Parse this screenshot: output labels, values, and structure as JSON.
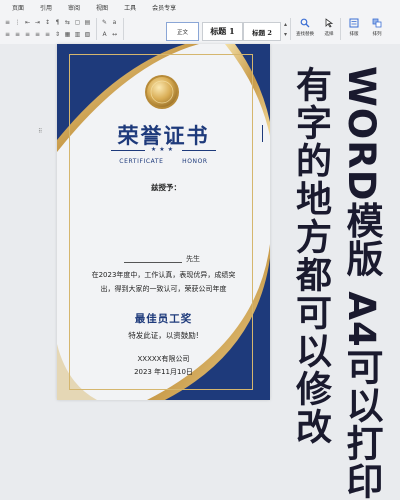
{
  "ribbon": {
    "menu": [
      "页面",
      "引用",
      "审阅",
      "视图",
      "工具",
      "会员专享"
    ],
    "styles": [
      "正文",
      "标题 1",
      "标题 2"
    ],
    "right_buttons": [
      {
        "label": "查找替换",
        "icon": "find-replace-icon"
      },
      {
        "label": "选择",
        "icon": "select-icon"
      },
      {
        "label": "排版",
        "icon": "layout-icon"
      },
      {
        "label": "排列",
        "icon": "arrange-icon"
      }
    ]
  },
  "certificate": {
    "title": "荣誉证书",
    "stars": "★★★",
    "subtitle_left": "CERTIFICATE",
    "subtitle_right": "HONOR",
    "award_to": "兹授予：",
    "honorific": "先生",
    "body_line1": "在2023年度中，工作认真，表现优异，成绩突",
    "body_line2": "出，得到大家的一致认可，荣获公司年度",
    "award_name": "最佳员工奖",
    "encourage": "特发此证，以资鼓励!",
    "company": "XXXXX有限公司",
    "date": "2023 年11月10日"
  },
  "promo": {
    "line1": "WORD模版 A4可以打印",
    "line2": "有字的地方都可以修改"
  },
  "colors": {
    "navy": "#1e3a7b",
    "gold": "#d5b66e",
    "ribbon_bg": "#f3f4f6",
    "canvas_bg": "#e9ebee"
  }
}
